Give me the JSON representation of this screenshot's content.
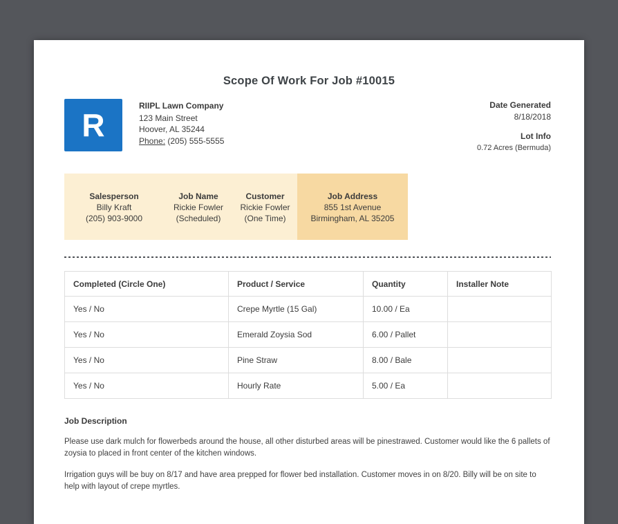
{
  "page": {
    "title": "Scope Of Work For Job #10015"
  },
  "company": {
    "logo_letter": "R",
    "name": "RIIPL Lawn Company",
    "address_line1": "123 Main Street",
    "address_line2": "Hoover, AL 35244",
    "phone_label": "Phone:",
    "phone": "(205) 555-5555"
  },
  "meta": {
    "date_generated_label": "Date Generated",
    "date_generated": "8/18/2018",
    "lot_info_label": "Lot Info",
    "lot_info": "0.72 Acres (Bermuda)"
  },
  "info_band": {
    "columns": [
      {
        "label": "Salesperson",
        "line1": "Billy Kraft",
        "line2": "(205) 903-9000"
      },
      {
        "label": "Job Name",
        "line1": "Rickie Fowler",
        "line2": "(Scheduled)"
      },
      {
        "label": "Customer",
        "line1": "Rickie Fowler",
        "line2": "(One Time)"
      },
      {
        "label": "Job Address",
        "line1": "855 1st Avenue",
        "line2": "Birmingham, AL 35205"
      }
    ]
  },
  "table": {
    "headers": [
      "Completed (Circle One)",
      "Product / Service",
      "Quantity",
      "Installer Note"
    ],
    "rows": [
      [
        "Yes / No",
        "Crepe Myrtle (15 Gal)",
        "10.00 / Ea",
        ""
      ],
      [
        "Yes / No",
        "Emerald Zoysia Sod",
        "6.00 / Pallet",
        ""
      ],
      [
        "Yes / No",
        "Pine Straw",
        "8.00 / Bale",
        ""
      ],
      [
        "Yes / No",
        "Hourly Rate",
        "5.00 / Ea",
        ""
      ]
    ]
  },
  "job_description": {
    "heading": "Job Description",
    "paragraphs": [
      "Please use dark mulch for flowerbeds around the house, all other disturbed areas will be pinestrawed. Customer would like the 6 pallets of zoysia to placed in front center of the kitchen windows.",
      "Irrigation guys will be buy on 8/17 and have area prepped for flower bed installation. Customer moves in on 8/20. Billy will be on site to help with layout of crepe myrtles."
    ]
  },
  "colors": {
    "logo_bg": "#1b74c5",
    "band_bg": "#fcefd3",
    "band_highlight": "#f7d9a2",
    "desktop_bg": "#54565b"
  }
}
